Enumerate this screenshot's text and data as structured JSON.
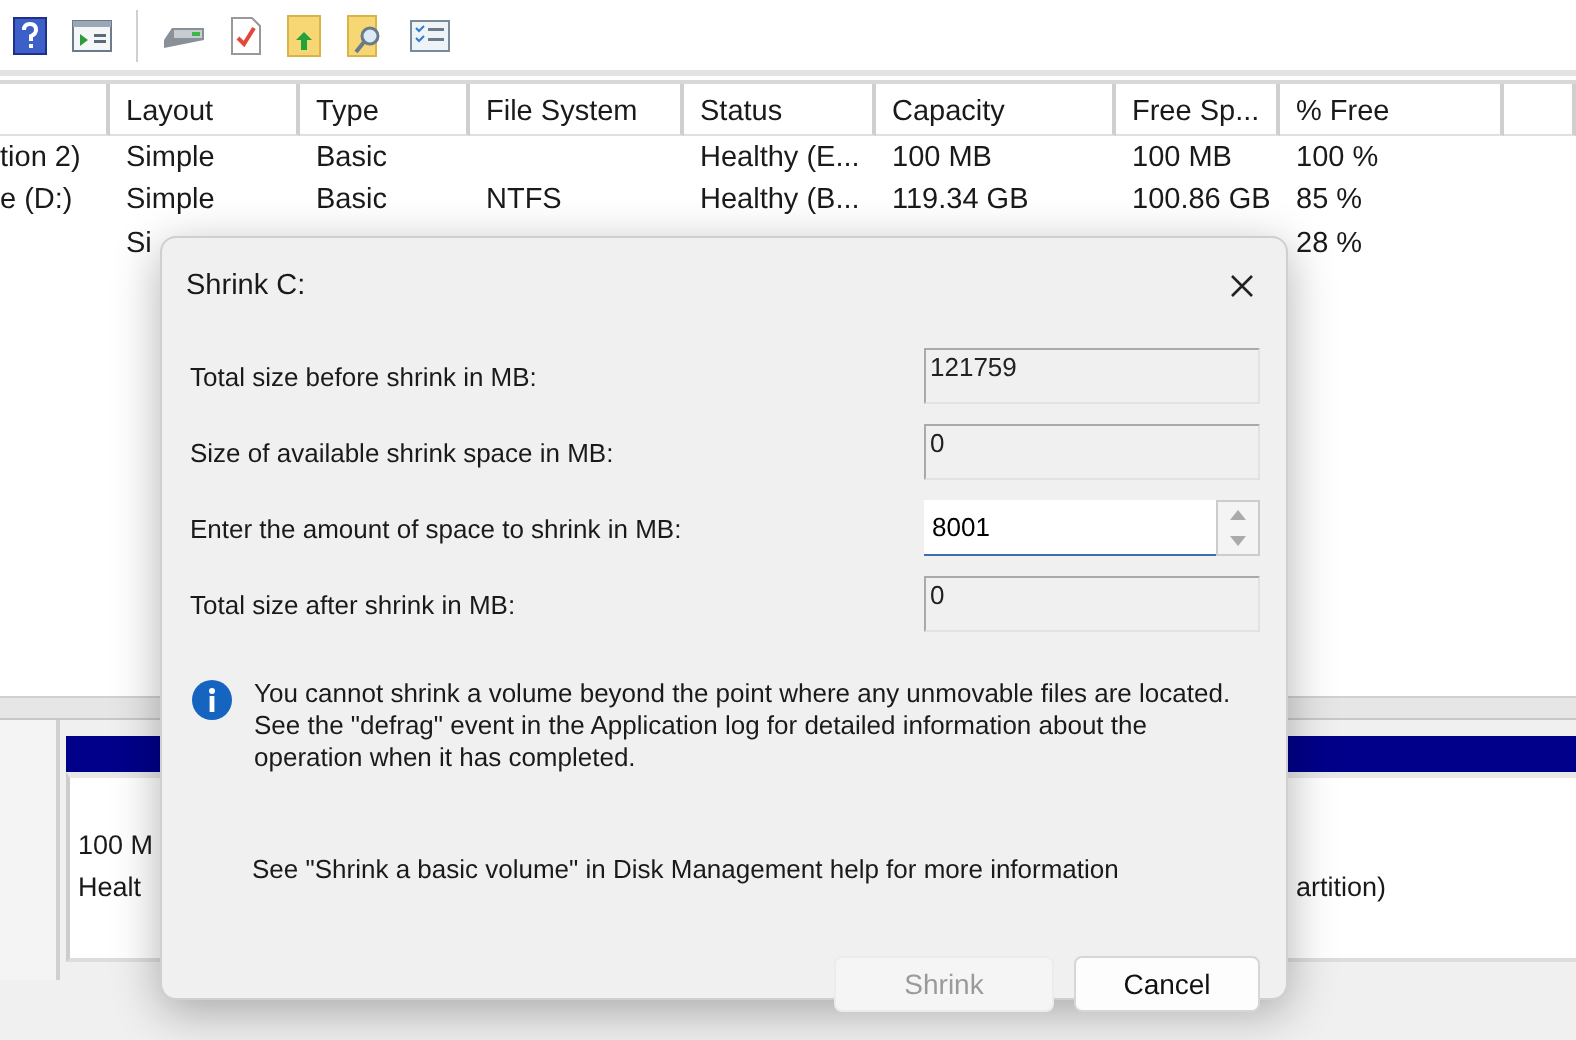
{
  "toolbar": {
    "buttons": [
      {
        "kind": "help"
      },
      {
        "kind": "window"
      },
      {
        "kind": "separator"
      },
      {
        "kind": "drive"
      },
      {
        "kind": "checklist"
      },
      {
        "kind": "folder-up"
      },
      {
        "kind": "folder-search"
      },
      {
        "kind": "list"
      }
    ]
  },
  "volume_table": {
    "columns": [
      "Layout",
      "Type",
      "File System",
      "Status",
      "Capacity",
      "Free Sp...",
      "% Free"
    ],
    "rows": [
      {
        "volume": "tion 2)",
        "layout": "Simple",
        "type": "Basic",
        "status": "Healthy (E...",
        "capacity": "100 MB",
        "free_space": "100 MB",
        "percent_free": "100 %"
      },
      {
        "volume": "e (D:)",
        "layout": "Simple",
        "type": "Basic",
        "file_system": "NTFS",
        "status": "Healthy (B...",
        "capacity": "119.34 GB",
        "free_space": "100.86 GB",
        "percent_free": "85 %"
      },
      {
        "layout": "Si",
        "percent_free": "28 %"
      }
    ]
  },
  "disk_map": {
    "partitions": [
      {
        "size": "100 M",
        "status": "Healt"
      },
      {
        "status": "artition)"
      }
    ]
  },
  "dialog": {
    "title": "Shrink C:",
    "fields": [
      {
        "label": "Total size before shrink in MB:",
        "value": "121759",
        "kind": "readonly"
      },
      {
        "label": "Size of available shrink space in MB:",
        "value": "0",
        "kind": "readonly"
      },
      {
        "label": "Enter the amount of space to shrink in MB:",
        "value": "8001",
        "kind": "spin"
      },
      {
        "label": "Total size after shrink in MB:",
        "value": "0",
        "kind": "readonly"
      }
    ],
    "info": "You cannot shrink a volume beyond the point where any unmovable files are located. See the \"defrag\" event in the Application log for detailed information about the operation when it has completed.",
    "help": "See \"Shrink a basic volume\" in Disk Management help for more information",
    "buttons": [
      {
        "label": "Shrink",
        "disabled": true
      },
      {
        "label": "Cancel",
        "disabled": false
      }
    ]
  }
}
